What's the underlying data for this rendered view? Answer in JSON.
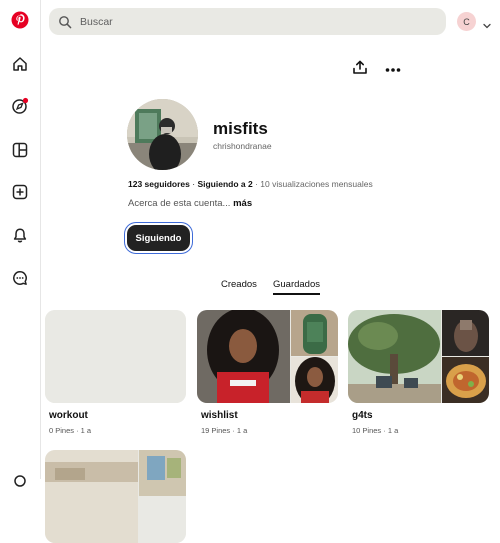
{
  "search": {
    "placeholder": "Buscar"
  },
  "account": {
    "initial": "C"
  },
  "profile": {
    "name": "misfits",
    "handle": "chrishondranae",
    "followers": "123 seguidores",
    "following": "Siguiendo a 2",
    "views": "10 visualizaciones mensuales",
    "about": "Acerca de esta cuenta...",
    "more": "más",
    "follow_button": "Siguiendo"
  },
  "tabs": [
    {
      "label": "Creados",
      "active": false
    },
    {
      "label": "Guardados",
      "active": true
    }
  ],
  "boards": [
    {
      "title": "workout",
      "meta": "0 Pines · 1 a"
    },
    {
      "title": "wishlist",
      "meta": "19 Pines · 1 a"
    },
    {
      "title": "g4ts",
      "meta": "10 Pines · 1 a"
    },
    {
      "title": "",
      "meta": ""
    }
  ],
  "colors": {
    "brand": "#e60023",
    "follow_button": "#222222",
    "focus_ring": "#3e6bd8"
  }
}
